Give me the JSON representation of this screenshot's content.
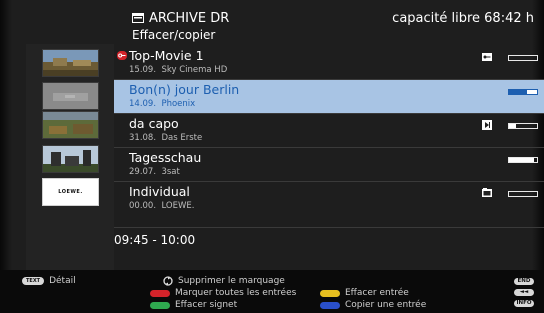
{
  "header": {
    "title": "ARCHIVE DR",
    "subtitle": "Effacer/copier",
    "capacity": "capacité libre 68:42 h"
  },
  "recordings": [
    {
      "title": "Top-Movie 1",
      "date": "15.09.",
      "channel": "Sky Cinema HD",
      "progress": 0.0,
      "locked": true,
      "flag": "key-flag-icon",
      "selected": false
    },
    {
      "title": "Bon(n) jour Berlin",
      "date": "14.09.",
      "channel": "Phoenix",
      "progress": 0.65,
      "locked": false,
      "flag": "",
      "selected": true
    },
    {
      "title": "da capo",
      "date": "31.08.",
      "channel": "Das Erste",
      "progress": 0.25,
      "locked": false,
      "flag": "play-flag-icon",
      "selected": false
    },
    {
      "title": "Tagesschau",
      "date": "29.07.",
      "channel": "3sat",
      "progress": 0.88,
      "locked": false,
      "flag": "",
      "selected": false
    },
    {
      "title": "Individual",
      "date": "00.00.",
      "channel": "LOEWE.",
      "progress": 0.0,
      "locked": false,
      "flag": "camera-flag-icon",
      "selected": false
    }
  ],
  "thumbnails": [
    {
      "name": "thumb-top-movie",
      "logo_text": ""
    },
    {
      "name": "thumb-bonn-jour",
      "logo_text": ""
    },
    {
      "name": "thumb-da-capo",
      "logo_text": ""
    },
    {
      "name": "thumb-tagesschau",
      "logo_text": ""
    },
    {
      "name": "thumb-individual",
      "logo_text": "LOEWE."
    }
  ],
  "time_range": "09:45 - 10:00",
  "footer": {
    "detail_badge": "TEXT",
    "detail_label": "Détail",
    "remove_mark": "Supprimer le marquage",
    "mark_all": "Marquer toutes les entrées",
    "delete_signet": "Effacer signet",
    "delete_entry": "Effacer entrée",
    "copy_entry": "Copier une entrée",
    "end_badge": "END",
    "back_badge": "◄◄",
    "info_badge": "INFO"
  },
  "colors": {
    "selected_bg": "#a8c4e4",
    "selected_text": "#1d5fb0",
    "red": "#d2232a",
    "green": "#2fa84f",
    "yellow": "#e8c020",
    "blue": "#2a4fc8"
  }
}
